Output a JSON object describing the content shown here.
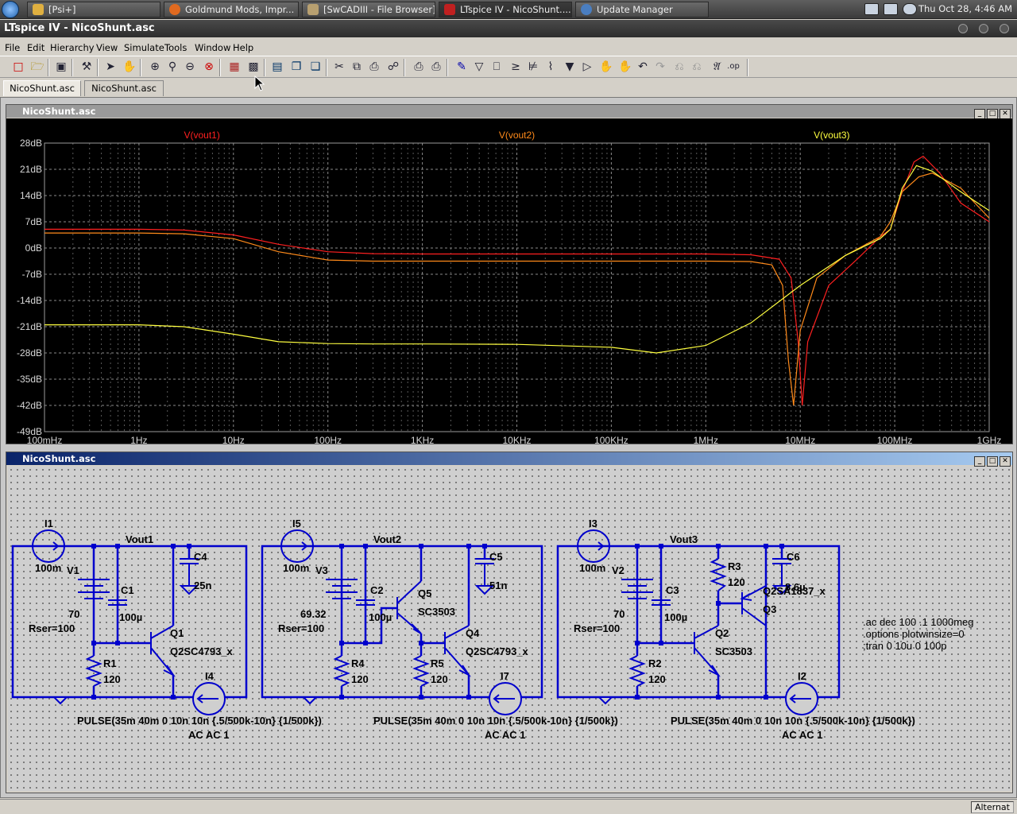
{
  "taskbar": {
    "tasks": [
      {
        "label": "[Psi+]"
      },
      {
        "label": "Goldmund Mods, Impr..."
      },
      {
        "label": "[SwCADIII - File Browser]"
      },
      {
        "label": "LTspice IV - NicoShunt...."
      },
      {
        "label": "Update Manager"
      }
    ],
    "clock": "Thu Oct 28,  4:46 AM"
  },
  "window": {
    "title": "LTspice IV - NicoShunt.asc"
  },
  "menu": [
    "File",
    "Edit",
    "Hierarchy",
    "View",
    "Simulate",
    "Tools",
    "Window",
    "Help"
  ],
  "doc_tabs": [
    "NicoShunt.asc",
    "NicoShunt.asc"
  ],
  "waveform_window": {
    "title": "NicoShunt.asc"
  },
  "schematic_window": {
    "title": "NicoShunt.asc"
  },
  "chart_data": {
    "type": "line",
    "xscale": "log",
    "xlim": [
      0.1,
      1000000000
    ],
    "ylim": [
      -49,
      28
    ],
    "grid": true,
    "background": "#000000",
    "legend_placement": "top",
    "xticks": [
      "100mHz",
      "1Hz",
      "10Hz",
      "100Hz",
      "1KHz",
      "10KHz",
      "100KHz",
      "1MHz",
      "10MHz",
      "100MHz",
      "1GHz"
    ],
    "yticks": [
      "28dB",
      "21dB",
      "14dB",
      "7dB",
      "0dB",
      "-7dB",
      "-14dB",
      "-21dB",
      "-28dB",
      "-35dB",
      "-42dB",
      "-49dB"
    ],
    "series": [
      {
        "name": "V(vout1)",
        "color": "#ff2020",
        "x": [
          0.1,
          1,
          3,
          10,
          30,
          100,
          300,
          1000,
          10000,
          100000,
          1000000,
          3000000,
          6000000,
          8000000,
          9500000,
          10500000,
          12000000,
          20000000,
          40000000,
          70000000,
          90000000,
          120000000,
          160000000,
          200000000,
          300000000,
          500000000,
          1000000000
        ],
        "y": [
          5,
          5,
          4.8,
          3.5,
          1,
          -1,
          -1.5,
          -1.6,
          -1.6,
          -1.6,
          -1.6,
          -1.8,
          -3,
          -8,
          -25,
          -42,
          -25,
          -10,
          -3,
          3,
          5,
          15,
          23,
          24.5,
          20,
          12,
          7
        ]
      },
      {
        "name": "V(vout2)",
        "color": "#ff8a1a",
        "x": [
          0.1,
          1,
          3,
          10,
          30,
          100,
          300,
          1000,
          10000,
          100000,
          1000000,
          3000000,
          5000000,
          6500000,
          7500000,
          8500000,
          10000000,
          15000000,
          30000000,
          70000000,
          90000000,
          120000000,
          180000000,
          250000000,
          500000000,
          1000000000
        ],
        "y": [
          4,
          4,
          3.8,
          2.5,
          -1,
          -3.2,
          -3.5,
          -3.5,
          -3.5,
          -3.5,
          -3.5,
          -3.6,
          -4.5,
          -10,
          -30,
          -42,
          -22,
          -8,
          -2,
          3,
          7,
          15,
          19,
          20,
          16,
          8
        ]
      },
      {
        "name": "V(vout3)",
        "color": "#ffff40",
        "x": [
          0.1,
          1,
          3,
          10,
          30,
          100,
          300,
          1000,
          10000,
          100000,
          300000,
          1000000,
          3000000,
          10000000,
          30000000,
          70000000,
          90000000,
          120000000,
          170000000,
          250000000,
          500000000,
          1000000000
        ],
        "y": [
          -20.5,
          -20.5,
          -21,
          -23,
          -25,
          -25.5,
          -25.6,
          -25.6,
          -25.7,
          -26.5,
          -28,
          -26,
          -20,
          -10,
          -2,
          2.5,
          5,
          16,
          22,
          20.5,
          15,
          10
        ]
      }
    ]
  },
  "schematic": {
    "netlabels": [
      "Vout1",
      "Vout2",
      "Vout3"
    ],
    "currents": [
      {
        "name": "I1",
        "value": "100m"
      },
      {
        "name": "I5",
        "value": "100m"
      },
      {
        "name": "I3",
        "value": "100m"
      },
      {
        "name": "I4",
        "value": ""
      },
      {
        "name": "I7",
        "value": ""
      },
      {
        "name": "I2",
        "value": ""
      }
    ],
    "voltages": [
      {
        "name": "V1",
        "value": "70",
        "rser": "Rser=100"
      },
      {
        "name": "V3",
        "value": "69.32",
        "rser": "Rser=100"
      },
      {
        "name": "V2",
        "value": "70",
        "rser": "Rser=100"
      }
    ],
    "caps": [
      {
        "name": "C1",
        "value": "100µ"
      },
      {
        "name": "C4",
        "value": "25n"
      },
      {
        "name": "C2",
        "value": "100µ"
      },
      {
        "name": "C5",
        "value": "51n"
      },
      {
        "name": "C3",
        "value": "100µ"
      },
      {
        "name": "C6",
        "value": "8.6µ"
      }
    ],
    "resistors": [
      {
        "name": "R1",
        "value": "120"
      },
      {
        "name": "R4",
        "value": "120"
      },
      {
        "name": "R5",
        "value": "120"
      },
      {
        "name": "R2",
        "value": "120"
      },
      {
        "name": "R3",
        "value": "120"
      }
    ],
    "transistors": [
      {
        "name": "Q1",
        "model": "Q2SC4793_x"
      },
      {
        "name": "Q5",
        "model": "SC3503"
      },
      {
        "name": "Q4",
        "model": "Q2SC4793_x"
      },
      {
        "name": "Q2",
        "model": "SC3503"
      },
      {
        "name": "Q3",
        "model": "Q2SA1837_x"
      }
    ],
    "pulse": "PULSE(35m 40m 0 10n 10n {.5/500k-10n} {1/500k})",
    "ac": "AC AC 1",
    "directives": [
      ".ac dec 100 .1 1000meg",
      ".options plotwinsize=0",
      ";tran 0 10u 0 100p"
    ]
  },
  "status": "Alternat"
}
